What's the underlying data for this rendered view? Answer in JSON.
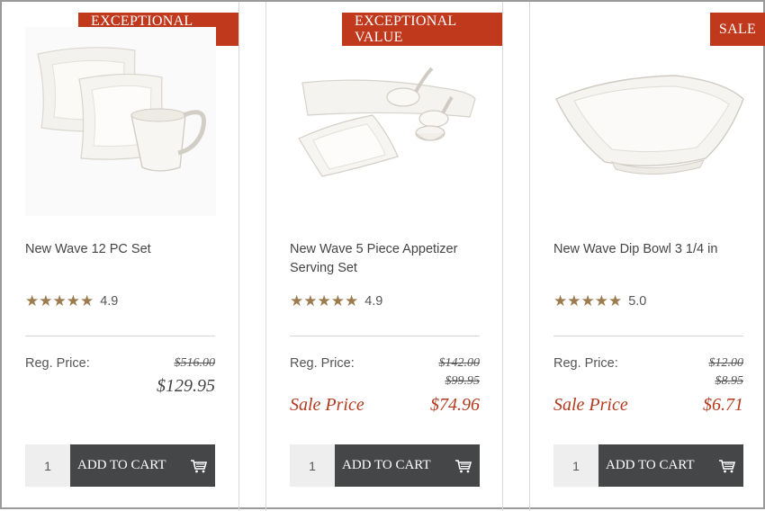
{
  "products": [
    {
      "badge": "EXCEPTIONAL VALUE",
      "name": "New Wave 12 PC Set",
      "rating_stars": "★★★★★",
      "rating": "4.9",
      "reg_label": "Reg. Price:",
      "orig_prices": [
        "$516.00"
      ],
      "price": "$129.95",
      "qty": "1",
      "cart_label": "ADD TO CART",
      "image": "dinnerware-set-image"
    },
    {
      "badge": "EXCEPTIONAL VALUE",
      "name": "New Wave 5 Piece Appetizer Serving Set",
      "rating_stars": "★★★★★",
      "rating": "4.9",
      "reg_label": "Reg. Price:",
      "orig_prices": [
        "$142.00",
        "$99.95"
      ],
      "sale_label": "Sale Price",
      "sale_price": "$74.96",
      "qty": "1",
      "cart_label": "ADD TO CART",
      "image": "appetizer-set-image"
    },
    {
      "badge": "SALE",
      "name": "New Wave Dip Bowl 3 1/4 in",
      "rating_stars": "★★★★★",
      "rating": "5.0",
      "reg_label": "Reg. Price:",
      "orig_prices": [
        "$12.00",
        "$8.95"
      ],
      "sale_label": "Sale Price",
      "sale_price": "$6.71",
      "qty": "1",
      "cart_label": "ADD TO CART",
      "image": "dip-bowl-image"
    }
  ],
  "colors": {
    "badge": "#c0391d",
    "sale": "#b23a1e",
    "star": "#9c7c4f",
    "button": "#444647"
  }
}
